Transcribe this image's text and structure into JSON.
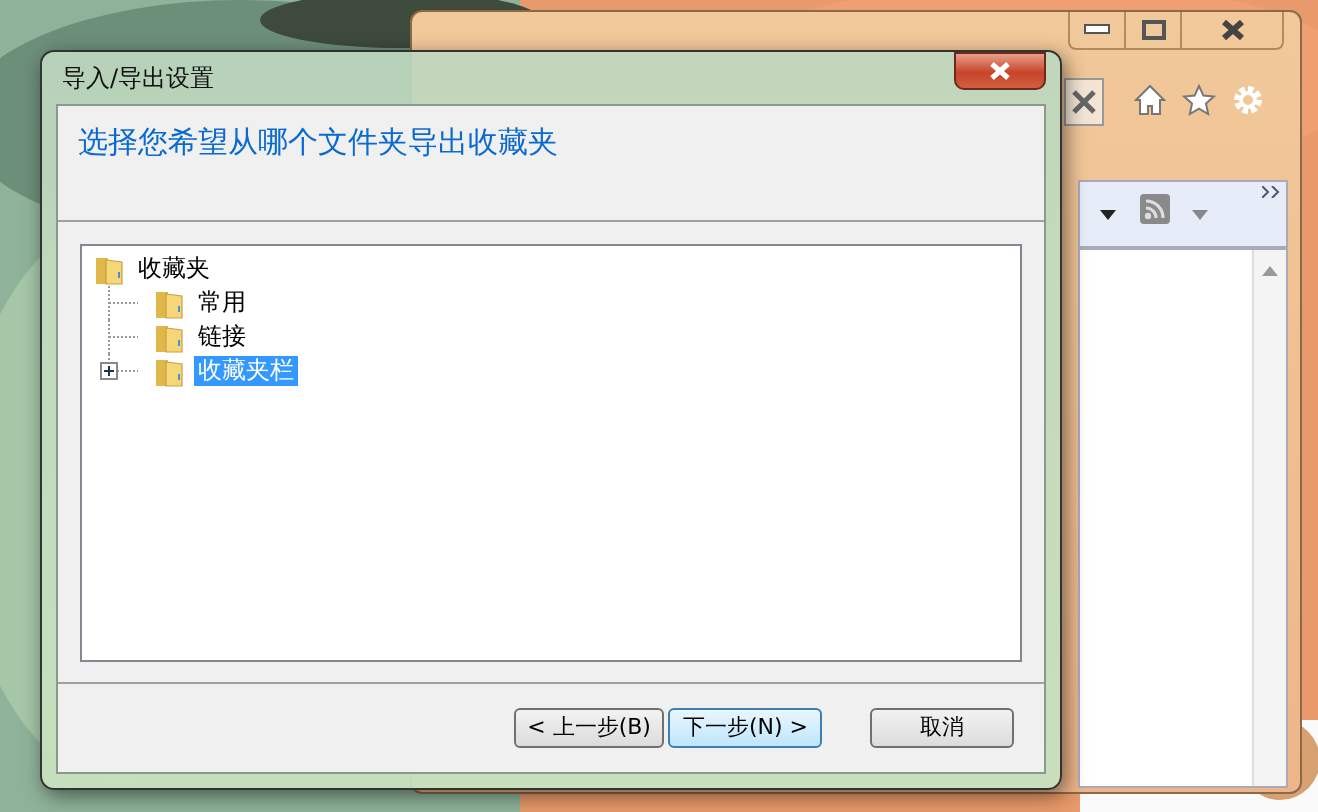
{
  "dialog": {
    "title": "导入/导出设置",
    "heading": "选择您希望从哪个文件夹导出收藏夹"
  },
  "tree": [
    {
      "label": "收藏夹",
      "selected": false,
      "children": [
        {
          "label": "常用",
          "selected": false
        },
        {
          "label": "链接",
          "selected": false
        },
        {
          "label": "收藏夹栏",
          "selected": true,
          "expanded": false
        }
      ]
    }
  ],
  "buttons": [
    {
      "label": "< 上一步(B)",
      "focused": false
    },
    {
      "label": "下一步(N) >",
      "focused": true
    },
    {
      "label": "取消",
      "focused": false
    }
  ]
}
